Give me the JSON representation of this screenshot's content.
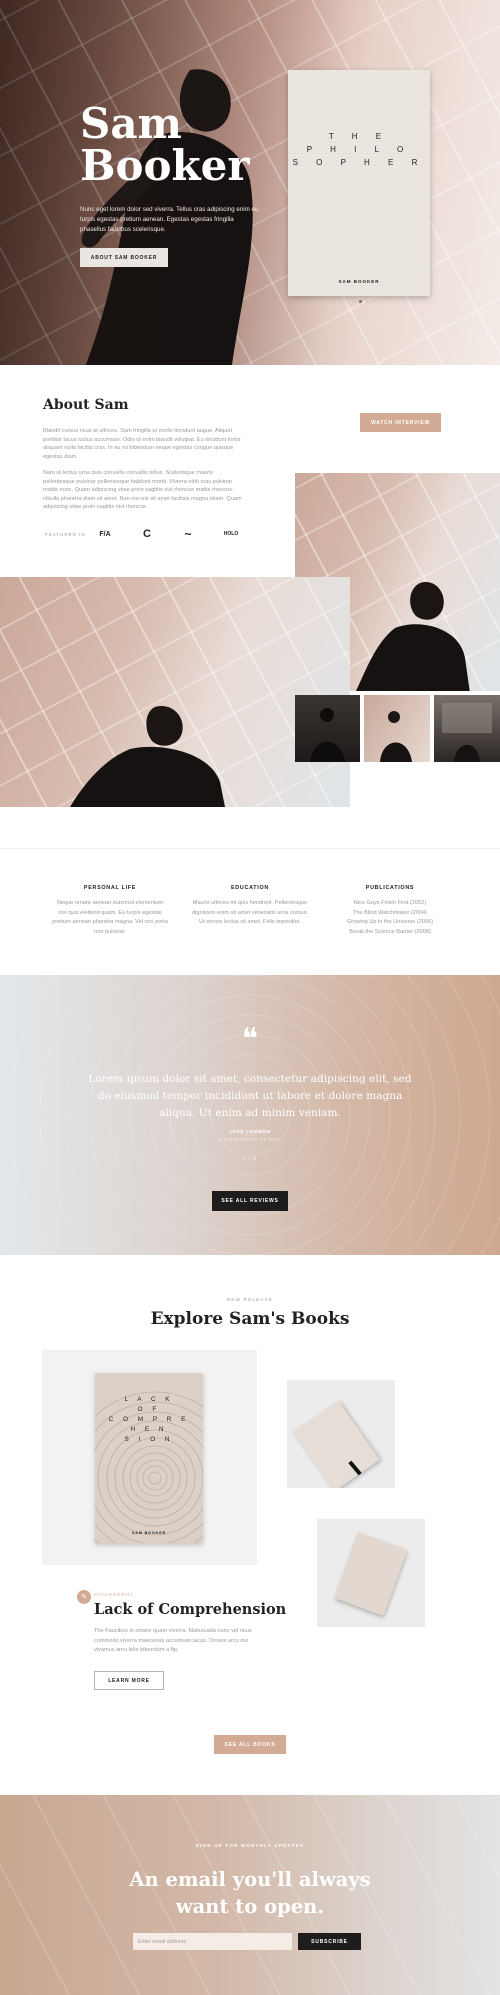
{
  "hero": {
    "title_line1": "Sam",
    "title_line2": "Booker",
    "text": "Nunc eget lorem dolor sed viverra. Tellus cras adipiscing enim eu turpis egestas pretium aenean. Egestas egestas fringilla phasellus faucibus scelerisque.",
    "button": "ABOUT SAM BOOKER",
    "book": {
      "title": "T H E\nP H I L O\nS O P H E R",
      "author": "SAM BOOKER"
    }
  },
  "about": {
    "title": "About Sam",
    "para1": "Blandit cursus risus at ultrices. Sam fringilla ut morbi tincidunt augue. Aliquet porttitor lacus luctus accumsan. Odio ut enim blandit volutpat. Eu tincidunt tortor aliquam nulla facilisi cras. In eu mi bibendum neque egestas congue quisque egestas diam.",
    "para2": "Nam at lectus urna duis convallis convallis tellus. Scelerisque mauris pellentesque pulvinar pellentesque habitant morbi. Viverra nibh cras pulvinar mattis nunc. Quam adipiscing vitae proin sagittis nisl rhoncus mattis rhoncus. nibulla pharetra diam sit amet. Non nisi est sit amet facilisis magna etiam. Quam adipiscing vitae proin sagittis nisl rhoncus.",
    "button": "WATCH INTERVIEW",
    "featured_label": "FEATURED IN",
    "logos": [
      "F/A",
      "C",
      "~",
      "HOLO"
    ]
  },
  "info": [
    {
      "heading": "PERSONAL LIFE",
      "text": "Neque ornare aenean euismod elementum nisi quis eleifend quam. Eu turpis egestas pretium aenean pharetra magna. Vel orci porta non pulvinar."
    },
    {
      "heading": "EDUCATION",
      "text": "Mauris ultrices mi quis hendrerit. Pellentesque dignissim enim sit amet venenatis urna cursus. Ut ornare lectus sit amet. Felis imperdiet."
    },
    {
      "heading": "PUBLICATIONS",
      "lines": [
        "Nice Guys Finish First (2002)",
        "The Blind Watchmaker (2004)",
        "Growing Up in the Universe (2006)",
        "Break the Science Barrier (2008)"
      ]
    }
  ],
  "testimonial": {
    "mark": "❝",
    "quote": "Lorem ipsum dolor sit amet, consectetur adipiscing elit, sed do eiusmod tempor incididunt ut labore et dolore magna aliqua. Ut enim ad minim veniam.",
    "name": "JANE LOMBON",
    "role": "CO-FOUNDER AT DIVI",
    "pager": "1 / 3",
    "button": "SEE ALL REVIEWS"
  },
  "books": {
    "kicker": "NEW RELEASE",
    "title": "Explore Sam's Books",
    "cover_title": "L A C K\nO F\nC O M P R E\nH E N\nS I O N",
    "cover_author": "SAM BOOKER",
    "category": "PHILOSOPHY",
    "book_title": "Lack of Comprehension",
    "book_text": "The Faucibus in ornare quam viverra. Malesuada nunc vel risus commodo viverra maecenas accumsan lacus. Ornare arcu dui vivamus arcu felis bibendum a ftp.",
    "learn_more": "LEARN MORE",
    "see_all": "SEE ALL BOOKS"
  },
  "newsletter": {
    "kicker": "SIGN UP FOR MONTHLY UPDATES",
    "title_line1": "An email you'll always",
    "title_line2": "want to open.",
    "placeholder": "Enter email address",
    "button": "SUBSCRIBE"
  },
  "colors": {
    "accent": "#d3ab95",
    "dark": "#1e1c1c"
  }
}
